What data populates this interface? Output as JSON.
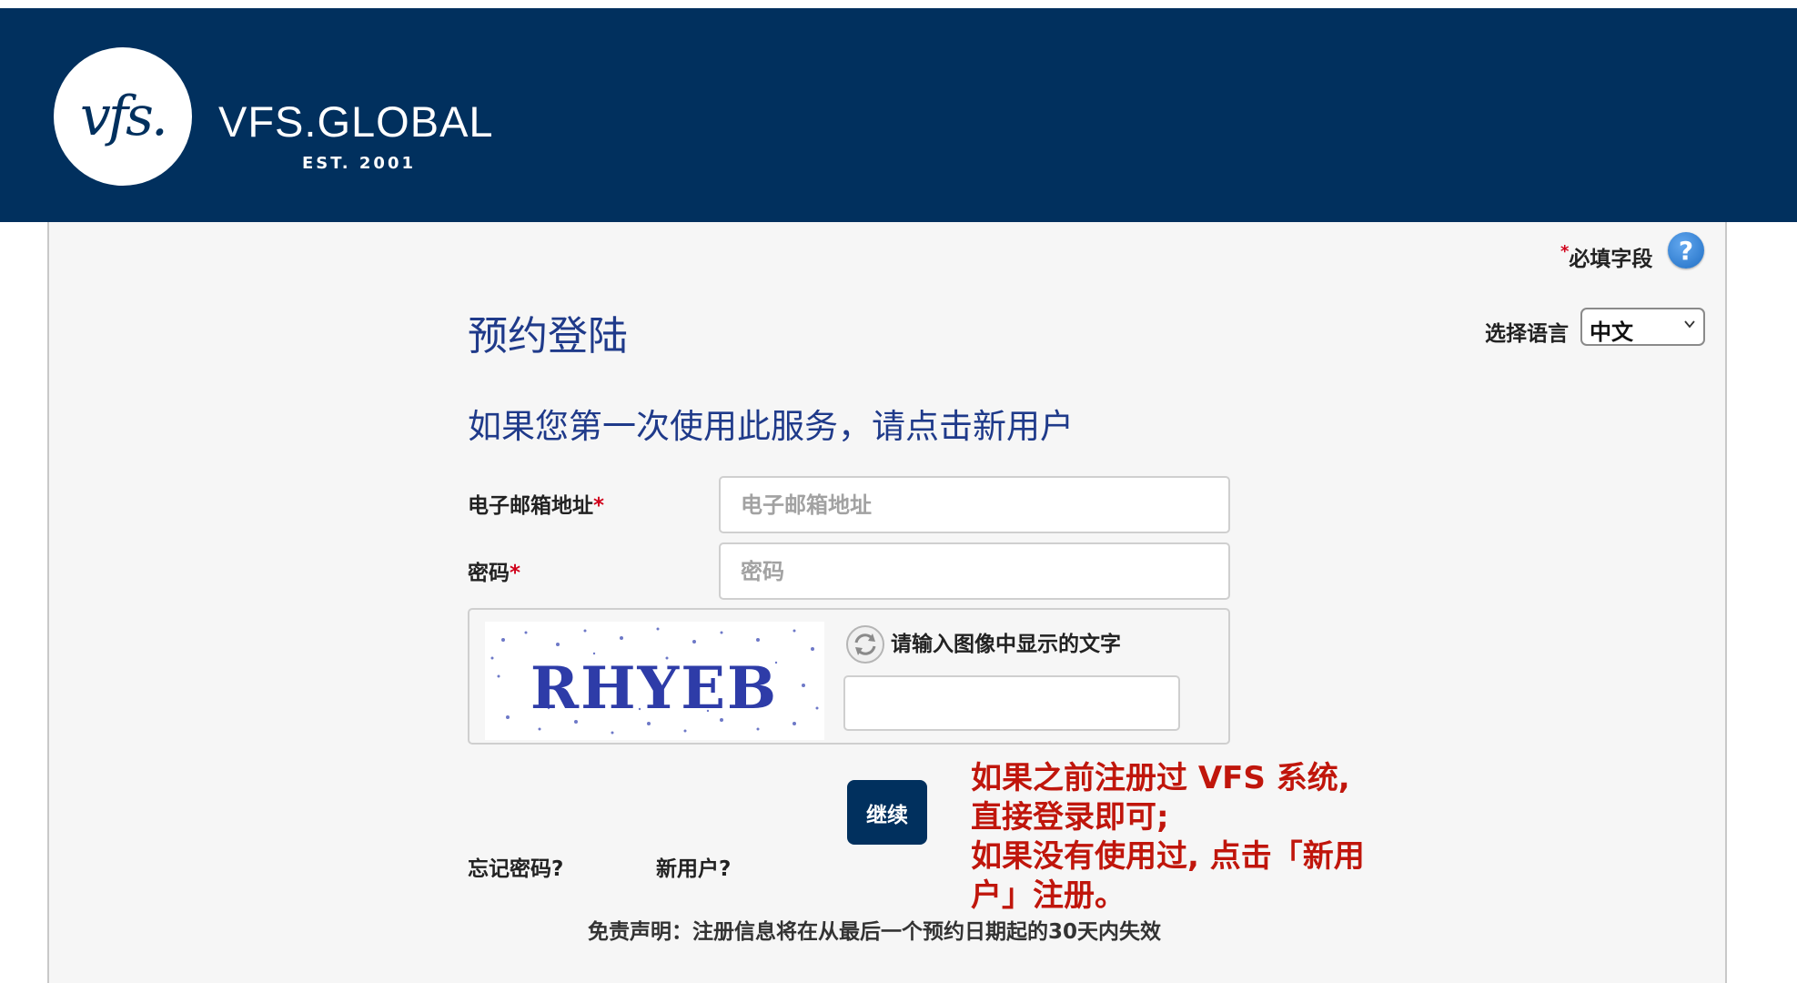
{
  "header": {
    "logo_text": "vfs.",
    "brand_name": "VFS.GLOBAL",
    "established": "EST. 2001",
    "background_color": "#01305e"
  },
  "required_note": {
    "star": "*",
    "text": "必填字段",
    "help_icon": "?"
  },
  "title": "预约登陆",
  "language": {
    "label": "选择语言",
    "selected": "中文",
    "icon": "chevron-down-icon"
  },
  "subtitle": "如果您第一次使用此服务，请点击新用户",
  "form": {
    "email_label": "电子邮箱地址",
    "email_placeholder": "电子邮箱地址",
    "password_label": "密码",
    "password_placeholder": "密码",
    "required_mark": "*",
    "captcha_text": "RHYEB",
    "captcha_prompt": "请输入图像中显示的文字",
    "captcha_value": "",
    "refresh_icon": "refresh-icon",
    "continue_label": "继续",
    "forgot_password": "忘记密码?",
    "new_user": "新用户?"
  },
  "annotation": {
    "line1": "如果之前注册过 VFS 系统,",
    "line2": "直接登录即可;",
    "line3": "如果没有使用过, 点击「新用",
    "line4": "户」注册。",
    "color": "#c0160c"
  },
  "disclaimer": "免责声明：注册信息将在从最后一个预约日期起的30天内失效"
}
